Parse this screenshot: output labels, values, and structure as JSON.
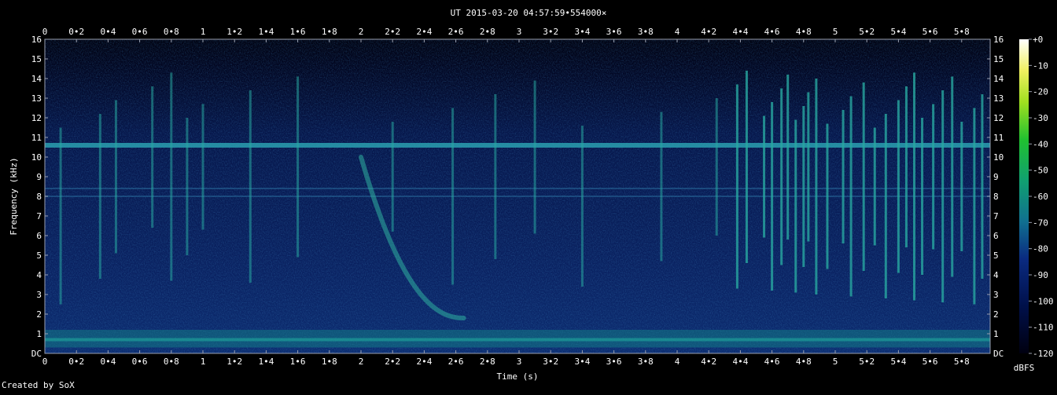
{
  "chart_data": {
    "type": "heatmap",
    "title": "UT 2015-03-20 04:57:59•554000×",
    "xlabel": "Time (s)",
    "ylabel": "Frequency (kHz)",
    "xlim": [
      0,
      5.96
    ],
    "ylim": [
      0,
      16
    ],
    "x_ticks": [
      "0",
      "0•2",
      "0•4",
      "0•6",
      "0•8",
      "1",
      "1•2",
      "1•4",
      "1•6",
      "1•8",
      "2",
      "2•2",
      "2•4",
      "2•6",
      "2•8",
      "3",
      "3•2",
      "3•4",
      "3•6",
      "3•8",
      "4",
      "4•2",
      "4•4",
      "4•6",
      "4•8",
      "5",
      "5•2",
      "5•4",
      "5•6",
      "5•8"
    ],
    "y_ticks": [
      "DC",
      "1",
      "2",
      "3",
      "4",
      "5",
      "6",
      "7",
      "8",
      "9",
      "10",
      "11",
      "12",
      "13",
      "14",
      "15",
      "16"
    ],
    "colorbar": {
      "label": "dBFS",
      "ticks": [
        "+0",
        "-10",
        "-20",
        "-30",
        "-40",
        "-50",
        "-60",
        "-70",
        "-80",
        "-90",
        "-100",
        "-110",
        "-120"
      ],
      "range": [
        -120,
        0
      ]
    },
    "features": {
      "constant_tone_khz": 10.6,
      "weak_tones_khz": [
        8.0,
        8.4
      ],
      "low_freq_band_khz": [
        0.3,
        1.2
      ],
      "whistler": {
        "t_start": 2.0,
        "f_start_khz": 10.0,
        "t_end": 2.65,
        "f_end_khz": 1.8
      },
      "sferics_s": [
        0.1,
        0.35,
        0.45,
        0.68,
        0.8,
        0.9,
        1.0,
        1.3,
        1.6,
        2.2,
        2.58,
        2.85,
        3.1,
        3.4,
        3.9,
        4.25,
        4.38,
        4.44,
        4.55,
        4.6,
        4.66,
        4.7,
        4.75,
        4.8,
        4.83,
        4.88,
        4.95,
        5.05,
        5.1,
        5.18,
        5.25,
        5.32,
        5.4,
        5.45,
        5.5,
        5.55,
        5.62,
        5.68,
        5.74,
        5.8,
        5.88,
        5.93
      ]
    }
  },
  "footer": {
    "credit": "Created by SoX"
  }
}
